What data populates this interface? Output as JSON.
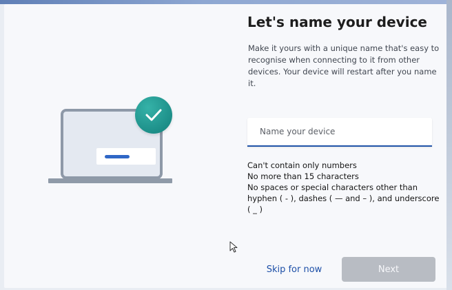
{
  "page": {
    "title": "Let's name your device",
    "description": "Make it yours with a unique name that's easy to recognise when connecting to it from other devices. Your device will restart after you name it."
  },
  "device_name_field": {
    "value": "",
    "placeholder": "Name your device"
  },
  "rules": [
    "Can't contain only numbers",
    "No more than 15 characters",
    "No spaces or special characters other than hyphen ( - ), dashes ( — and – ), and underscore ( _ )"
  ],
  "buttons": {
    "skip_label": "Skip for now",
    "next_label": "Next",
    "next_enabled": false
  },
  "colors": {
    "accent": "#2053a8",
    "check_badge": "#1d8f89",
    "next_disabled": "#b8bcc3",
    "link": "#1d4fa7"
  },
  "icons": {
    "illustration": "laptop-icon",
    "badge": "checkmark-icon",
    "pointer": "mouse-cursor-icon"
  }
}
